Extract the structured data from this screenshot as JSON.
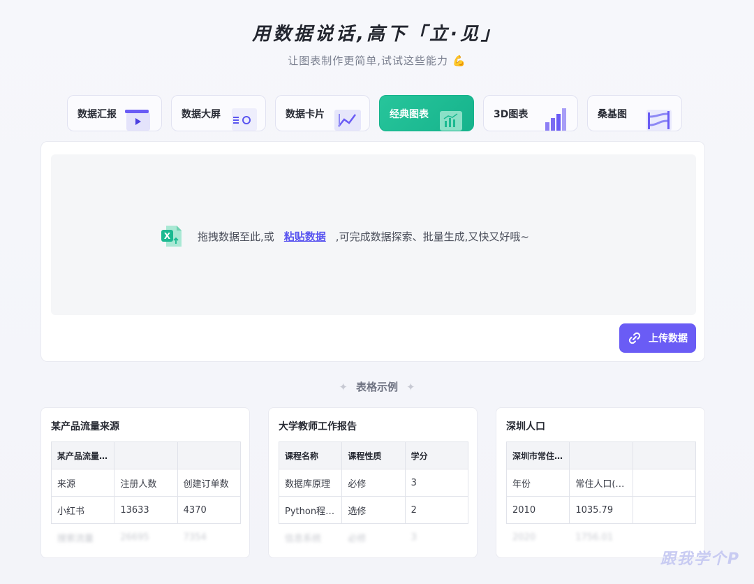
{
  "hero": {
    "title": "用数据说话,高下「立·见」",
    "subtitle": "让图表制作更简单,试试这些能力",
    "emoji": "💪"
  },
  "tabs": [
    {
      "label": "数据汇报",
      "icon": "report-icon",
      "active": false
    },
    {
      "label": "数据大屏",
      "icon": "dashboard-icon",
      "active": false
    },
    {
      "label": "数据卡片",
      "icon": "card-chart-icon",
      "active": false
    },
    {
      "label": "经典图表",
      "icon": "classic-chart-icon",
      "active": true
    },
    {
      "label": "3D图表",
      "icon": "3d-bar-icon",
      "active": false
    },
    {
      "label": "桑基图",
      "icon": "sankey-icon",
      "active": false
    }
  ],
  "upload": {
    "icon": "excel-file-icon",
    "drop_prefix": "拖拽数据至此,或",
    "paste_link": "粘贴数据",
    "drop_suffix": ",可完成数据探索、批量生成,又快又好哦~",
    "button_label": "上传数据",
    "button_icon": "link-icon"
  },
  "examples": {
    "title": "表格示例",
    "cards": [
      {
        "title": "某产品流量来源",
        "rows": [
          [
            "某产品流量来源",
            "",
            ""
          ],
          [
            "来源",
            "注册人数",
            "创建订单数"
          ],
          [
            "小红书",
            "13633",
            "4370"
          ],
          [
            "搜索流量",
            "26695",
            "7354"
          ]
        ]
      },
      {
        "title": "大学教师工作报告",
        "rows": [
          [
            "课程名称",
            "课程性质",
            "学分"
          ],
          [
            "数据库原理",
            "必修",
            "3"
          ],
          [
            "Python程序设计",
            "选修",
            "2"
          ],
          [
            "信息系统",
            "必修",
            "3"
          ]
        ]
      },
      {
        "title": "深圳人口",
        "rows": [
          [
            "深圳市常住人口",
            "",
            ""
          ],
          [
            "年份",
            "常住人口(万人)",
            ""
          ],
          [
            "2010",
            "1035.79",
            ""
          ],
          [
            "2020",
            "1756.01",
            ""
          ]
        ]
      }
    ]
  },
  "watermark": "跟我学个P",
  "colors": {
    "accent": "#6a5cf5",
    "active_tab": "#1bb991",
    "link": "#5a55f0"
  }
}
